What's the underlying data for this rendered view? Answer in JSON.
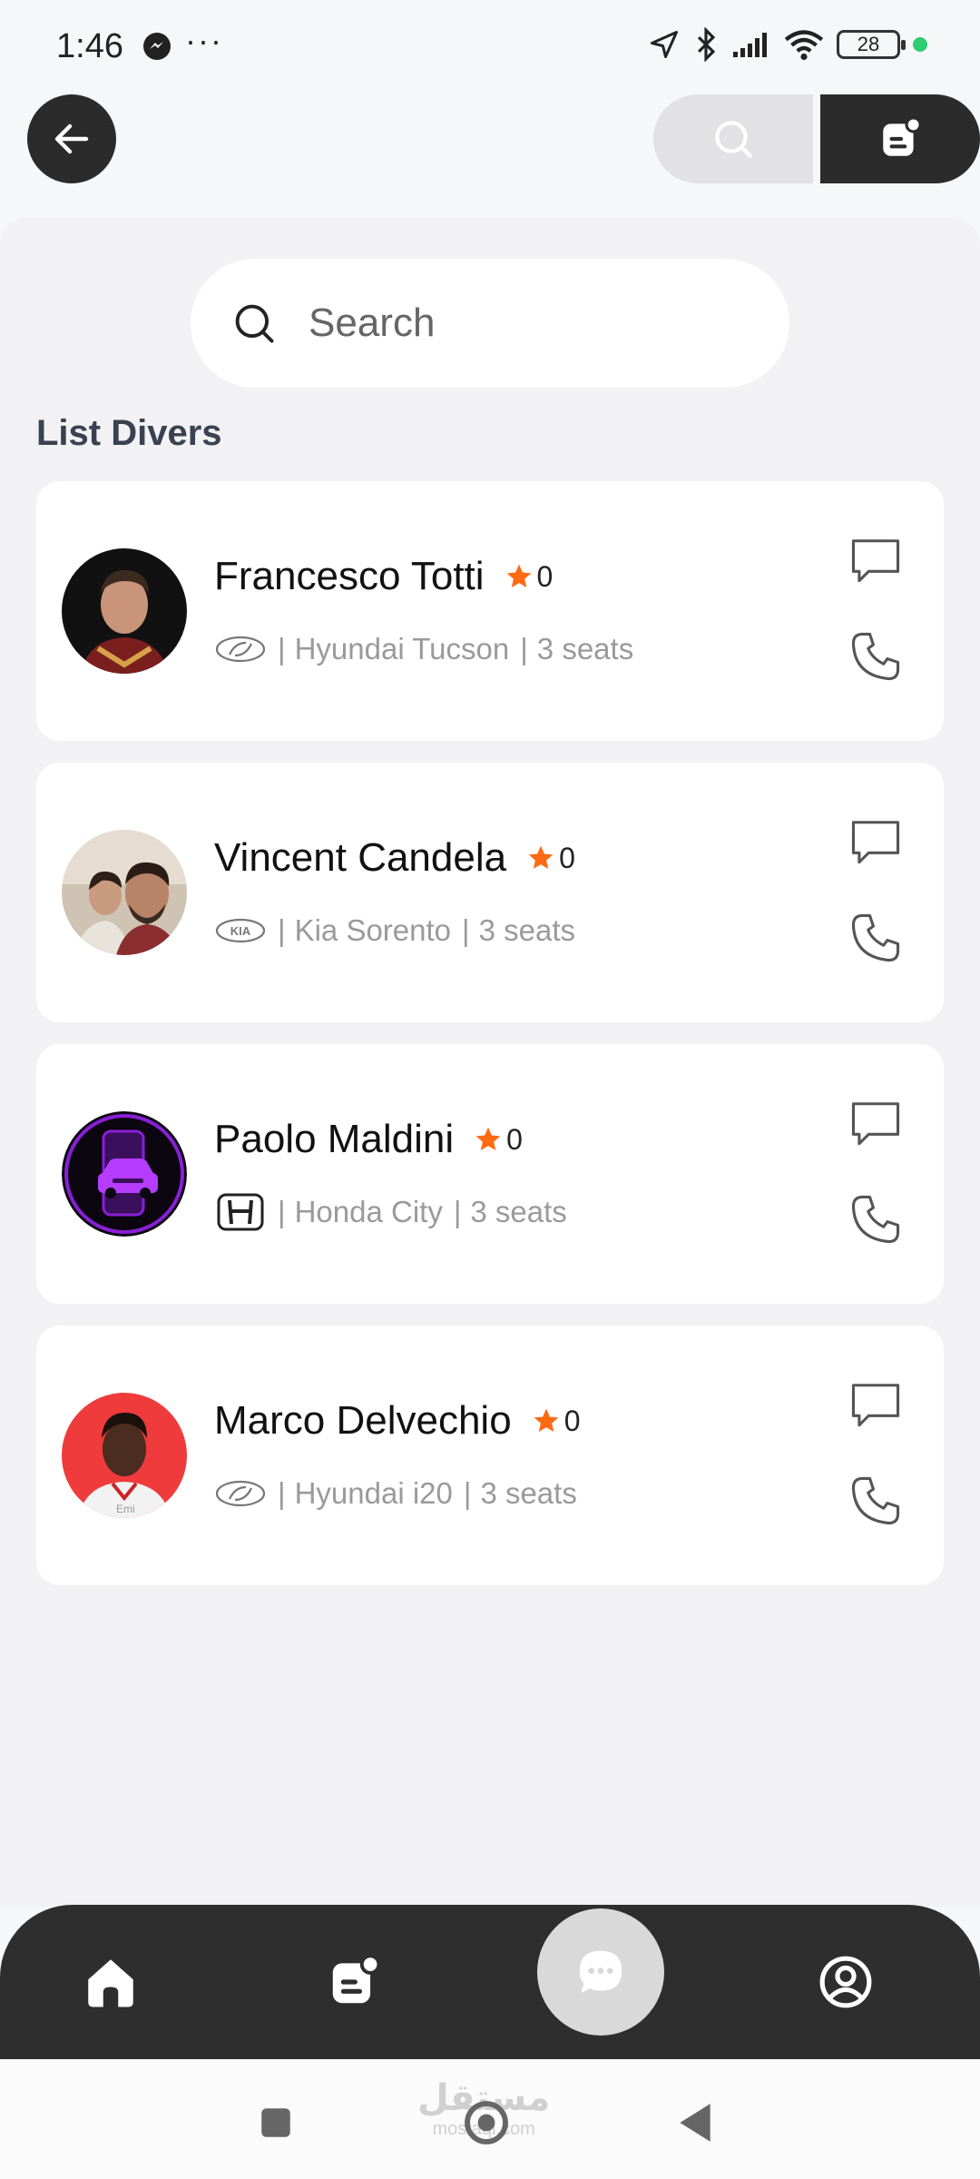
{
  "status_bar": {
    "time": "1:46",
    "more": "···",
    "battery": "28"
  },
  "header": {
    "back_icon": "arrow-left-icon",
    "search_icon": "search-icon",
    "doc_icon": "document-badge-icon"
  },
  "search": {
    "placeholder": "Search"
  },
  "section_title": "List Divers",
  "drivers": [
    {
      "name": "Francesco Totti",
      "rating": "0",
      "brand": "hyundai",
      "car": "Hyundai Tucson",
      "seats": "3 seats"
    },
    {
      "name": "Vincent Candela",
      "rating": "0",
      "brand": "kia",
      "car": "Kia Sorento",
      "seats": "3 seats"
    },
    {
      "name": "Paolo Maldini",
      "rating": "0",
      "brand": "honda",
      "car": "Honda City",
      "seats": "3 seats"
    },
    {
      "name": "Marco Delvechio",
      "rating": "0",
      "brand": "hyundai",
      "car": "Hyundai i20",
      "seats": "3 seats"
    }
  ],
  "separator": "|",
  "bottom_nav": {
    "items": [
      "home-icon",
      "document-badge-icon",
      "chat-bubble-icon",
      "profile-icon"
    ],
    "active": "chat-bubble-icon"
  },
  "watermark": {
    "text": "مستقل",
    "sub": "mostaql.com"
  },
  "colors": {
    "accent_dark": "#2b2b2b",
    "star": "#ff6a13",
    "background": "#f2f2f4"
  }
}
